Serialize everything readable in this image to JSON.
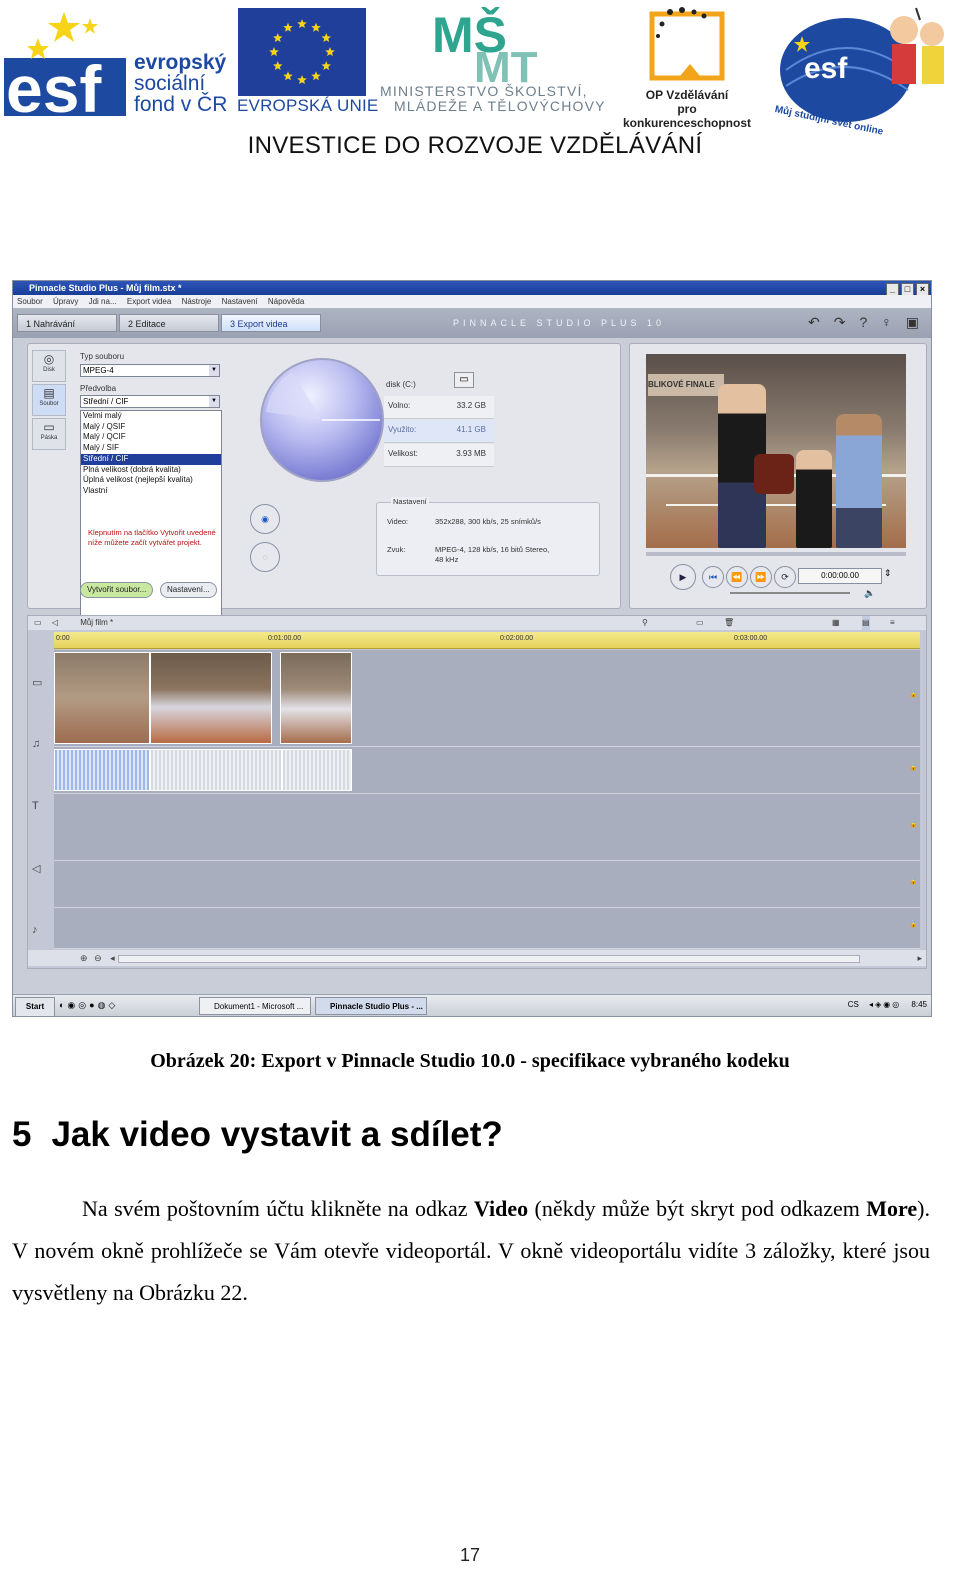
{
  "header": {
    "esf_lines": [
      "evropský",
      "sociální",
      "fond v ČR"
    ],
    "eu_caption": "EVROPSKÁ UNIE",
    "msmt_lines": [
      "MINISTERSTVO ŠKOLSTVÍ,",
      "MLÁDEŽE A TĚLOVÝCHOVY"
    ],
    "op_lines": [
      "OP Vzdělávání",
      "pro konkurenceschopnost"
    ],
    "esf_online": "Můj studijní svět online",
    "slogan": "INVESTICE DO ROZVOJE  VZDĚLÁVÁNÍ",
    "colors": {
      "eu_blue": "#1f3f9b",
      "star_yellow": "#f7d417",
      "esf_blue": "#1d4aa0",
      "msmt_teal": "#2fa58f",
      "op_orange": "#f2a41b"
    }
  },
  "screenshot": {
    "title": "Pinnacle Studio Plus - Můj film.stx *",
    "menu": [
      "Soubor",
      "Úpravy",
      "Jdi na...",
      "Export videa",
      "Nástroje",
      "Nastavení",
      "Nápověda"
    ],
    "tabs": [
      "1  Nahrávání",
      "2  Editace",
      "3  Export videa"
    ],
    "brand": "PINNACLE STUDIO PLUS 10",
    "vtabs": [
      "Disk",
      "Soubor",
      "Páska"
    ],
    "file_type_label": "Typ souboru",
    "file_type_value": "MPEG-4",
    "preset_label": "Předvolba",
    "preset_value": "Střední / CIF",
    "preset_options": [
      "Velmi malý",
      "Malý / QSIF",
      "Malý / QCIF",
      "Malý / SIF",
      "Střední / CIF",
      "Plná velikost (dobrá kvalita)",
      "Úplná velikost (nejlepší kvalita)",
      "Vlastní"
    ],
    "hint": "Klepnutím na tlačítko Vytvořit uvedené níže můžete začít vytvářet projekt.",
    "create_button": "Vytvořit soubor...",
    "settings_button": "Nastavení...",
    "disk": {
      "label": "disk (C:)",
      "rows": [
        {
          "k": "Volno:",
          "v": "33.2 GB"
        },
        {
          "k": "Využito:",
          "v": "41.1 GB"
        },
        {
          "k": "Velikost:",
          "v": "3.93 MB"
        }
      ]
    },
    "nastaveni": {
      "title": "Nastavení",
      "video_label": "Video:",
      "video_value": "352x288, 300 kb/s, 25 snímků/s",
      "audio_label": "Zvuk:",
      "audio_value": "MPEG-4, 128 kb/s, 16 bitů Stereo, 48 kHz"
    },
    "video_banner": "BLIKOVÉ FINALE",
    "timecode": "0:00:00.00",
    "timeline_title": "Můj film *",
    "ruler_ticks": [
      "0:00",
      "0:01:00.00",
      "0:02:00.00",
      "0:03:00.00"
    ],
    "taskbar": {
      "start": "Start",
      "tasks": [
        "Dokument1 - Microsoft ...",
        "Pinnacle Studio Plus - ..."
      ],
      "clock": "8:45",
      "lang": "CS"
    }
  },
  "caption": "Obrázek 20: Export v Pinnacle Studio 10.0 - specifikace vybraného kodeku",
  "section": {
    "number": "5",
    "title": "Jak video vystavit a sdílet?"
  },
  "paragraph": {
    "p1": "Na svém poštovním účtu klikněte na odkaz ",
    "b1": "Video",
    "p2": " (někdy může být skryt pod odkazem ",
    "b2": "More",
    "p3": "). V novém okně prohlížeče se Vám otevře videoportál. V okně videoportálu vidíte 3 záložky, které jsou vysvětleny na Obrázku 22."
  },
  "page_number": "17"
}
